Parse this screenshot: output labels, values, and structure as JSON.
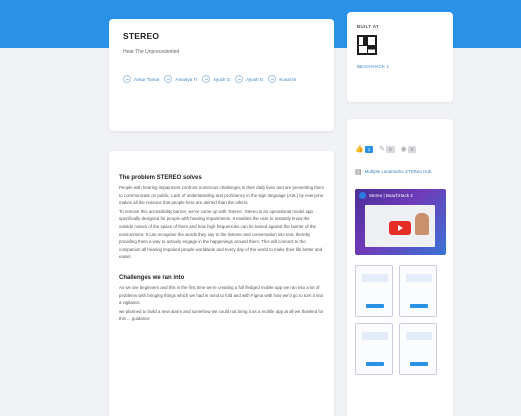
{
  "header": {
    "title": "STEREO",
    "tagline": "Hear The Unprecedented",
    "chips": [
      {
        "label": "Ankur Tomar"
      },
      {
        "label": "Amartya Ti"
      },
      {
        "label": "Ayush G"
      },
      {
        "label": "Ayush G"
      },
      {
        "label": "Kunal M"
      }
    ]
  },
  "content": {
    "sections": [
      {
        "heading": "The problem STEREO solves",
        "paragraphs": [
          "People with hearing impairment confront numerous challenges in their daily lives and are preventing them to communicate on public. Lack of understanding and proficiency in the sign language (ASL) by everyone makes all the reasons that people here are alerted than the others.",
          "To remove this accessibility barrier, we've come up with 'Stereo'. Stereo is an operational model app specifically designed for people with hearing impairments. It enables the user to instantly know the outside noises of the space of them and how high frequencies can be tamed against the barrier of the environment. It can recognise the words they say to the listener and conversation into text, thereby providing them a way to actively engage in the happenings around them. This will connect to the companion all hearing impaired people worldwide and every day of the world to make their life better and easier."
        ]
      },
      {
        "heading": "Challenges we ran into",
        "paragraphs": [
          "As we are beginners and this is the first time we're creating a full fledged mobile app we ran into a lot of problems with bringing things which we had in mind to fold and with Figma with how we'd go to turn it into a vigilance.",
          "we planned to build a new alarm and somehow we could not bring it as a mobile app at all we thanked for this ... guidance"
        ]
      }
    ]
  },
  "sponsor": {
    "label": "BUILT AT",
    "name": "BEACHHACK 4"
  },
  "sidebar": {
    "votes": [
      {
        "count": "1"
      },
      {
        "count": "0"
      },
      {
        "count": "0"
      }
    ],
    "doc_link": "Multiple Landmarks STEReo Hub",
    "video": {
      "title": "Stereo | BeachHack 4",
      "subtitle": "WATCH"
    }
  }
}
